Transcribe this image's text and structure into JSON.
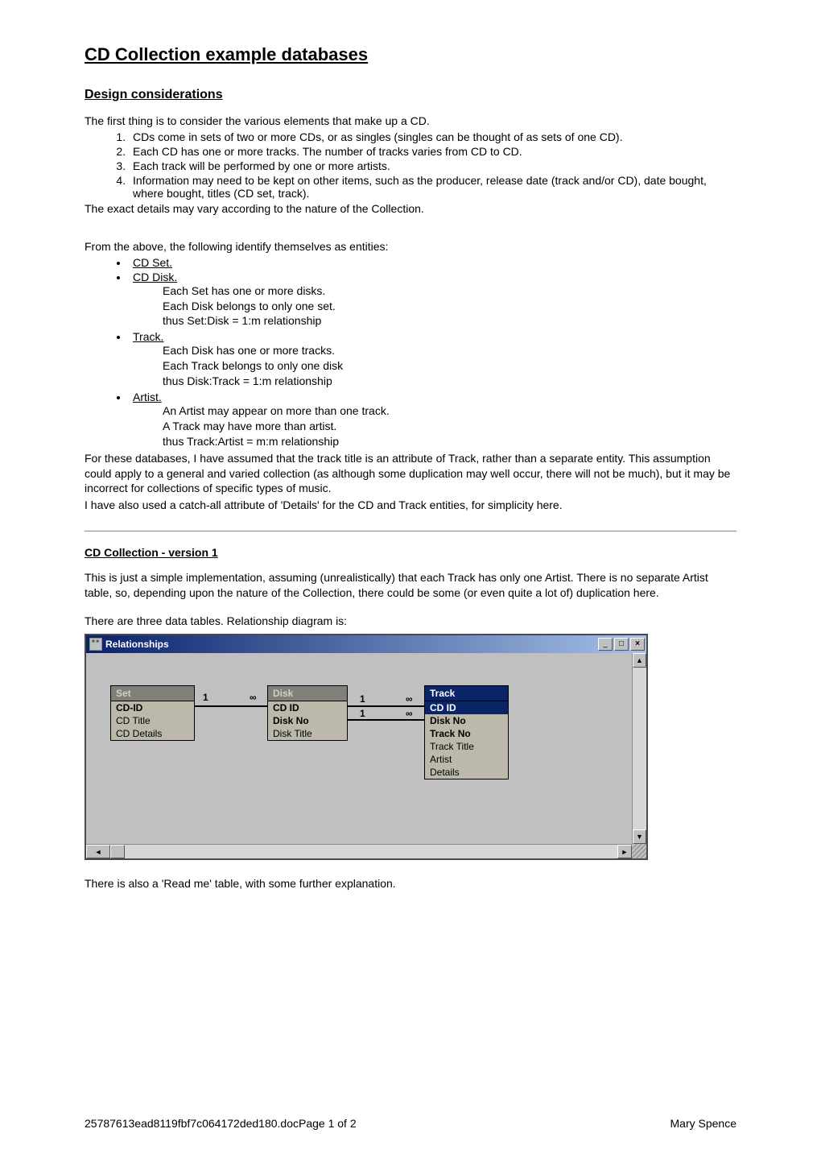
{
  "doc": {
    "title": "CD Collection example databases",
    "section_design": "Design considerations",
    "intro": "The first thing is to consider the various elements that make up a CD.",
    "numbered": [
      "CDs come in sets of two or more CDs, or as singles (singles can be thought of as sets of one CD).",
      "Each CD has one or more tracks. The number of tracks varies from CD to CD.",
      "Each track will be performed by one or more artists.",
      "Information may need to be kept on other items, such as the producer, release date (track and/or CD), date bought, where bought, titles (CD set, track)."
    ],
    "intro_after": "The exact details may vary according to the nature of the Collection.",
    "entities_intro": "From the above, the following identify themselves as entities:",
    "entities": [
      {
        "name": "CD Set.",
        "lines": []
      },
      {
        "name": "CD Disk.",
        "lines": [
          "Each Set has one or more disks.",
          "Each Disk belongs to only one set.",
          "thus Set:Disk = 1:m relationship"
        ]
      },
      {
        "name": "Track.",
        "lines": [
          "Each Disk has one or more tracks.",
          "Each Track belongs to only one disk",
          "thus Disk:Track = 1:m relationship"
        ]
      },
      {
        "name": "Artist.",
        "lines": [
          "An Artist may appear on more than one track.",
          "A Track may have more than artist.",
          "thus Track:Artist = m:m relationship"
        ]
      }
    ],
    "assumption": "For these databases, I have assumed that the track title is an attribute of Track, rather than a separate entity. This assumption could apply to a general and varied collection (as although some duplication may well occur, there will not be much), but it may be incorrect for collections of specific types of music.",
    "catchall": "I have also used a catch-all attribute of 'Details' for the CD and Track entities, for simplicity here.",
    "v1_title": "CD Collection - version 1",
    "v1_p1": "This is just a simple implementation, assuming (unrealistically) that each Track has only one Artist. There is no separate Artist table, so, depending upon the nature of the Collection, there could be some (or even quite a lot of) duplication here.",
    "v1_p2": "There are three data tables. Relationship diagram is:",
    "v1_p3": "There is also a 'Read me' table, with some further explanation."
  },
  "rel": {
    "window_title": "Relationships",
    "tables": {
      "set": {
        "title": "Set",
        "fields": [
          "CD-ID",
          "CD Title",
          "CD Details"
        ],
        "bold": [
          0
        ]
      },
      "disk": {
        "title": "Disk",
        "fields": [
          "CD ID",
          "Disk No",
          "Disk Title"
        ],
        "bold": [
          0,
          1
        ]
      },
      "track": {
        "title": "Track",
        "fields": [
          "CD ID",
          "Disk No",
          "Track No",
          "Track Title",
          "Artist",
          "Details"
        ],
        "bold": [
          0,
          1,
          2
        ]
      }
    },
    "links": {
      "one": "1",
      "many": "∞"
    }
  },
  "footer": {
    "left": "25787613ead8119fbf7c064172ded180.docPage 1 of 2",
    "right": "Mary Spence"
  }
}
